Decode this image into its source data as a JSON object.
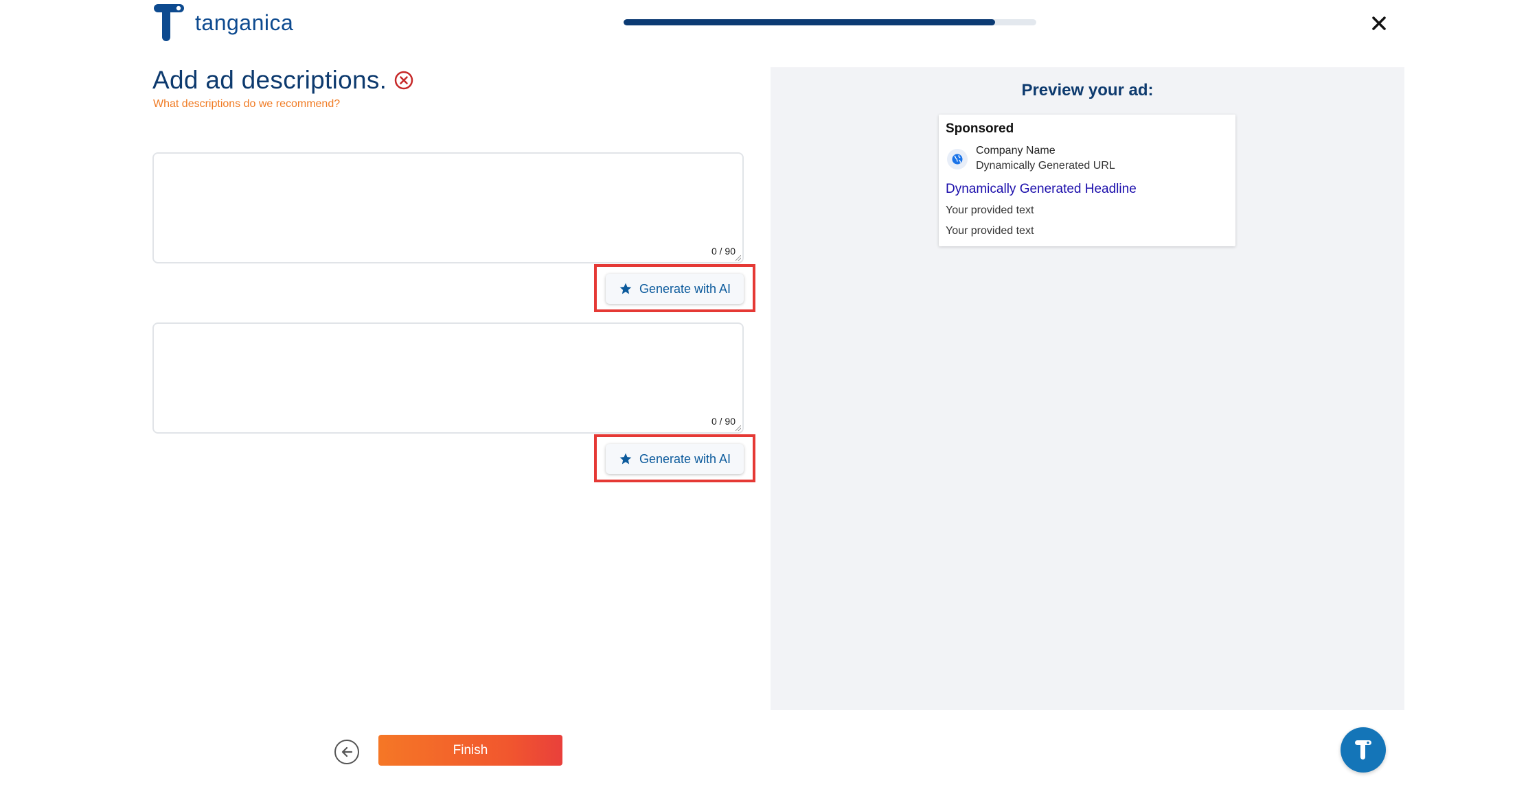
{
  "header": {
    "brand": "tanganica",
    "progress_percent": 90
  },
  "form": {
    "title": "Add ad descriptions.",
    "help_link": "What descriptions do we recommend?",
    "descriptions": [
      {
        "value": "",
        "counter": "0 / 90",
        "generate_label": "Generate with AI"
      },
      {
        "value": "",
        "counter": "0 / 90",
        "generate_label": "Generate with AI"
      }
    ]
  },
  "footer": {
    "finish_label": "Finish"
  },
  "preview": {
    "title": "Preview your ad:",
    "sponsored": "Sponsored",
    "company_name": "Company Name",
    "url": "Dynamically Generated URL",
    "headline": "Dynamically Generated Headline",
    "text_lines": [
      "Your provided text",
      "Your provided text"
    ]
  },
  "colors": {
    "brand_navy": "#0d3a6e",
    "accent_orange": "#f07a22",
    "highlight_red": "#e53935",
    "preview_bg": "#f2f3f6",
    "headline_blue": "#1a0dab"
  }
}
